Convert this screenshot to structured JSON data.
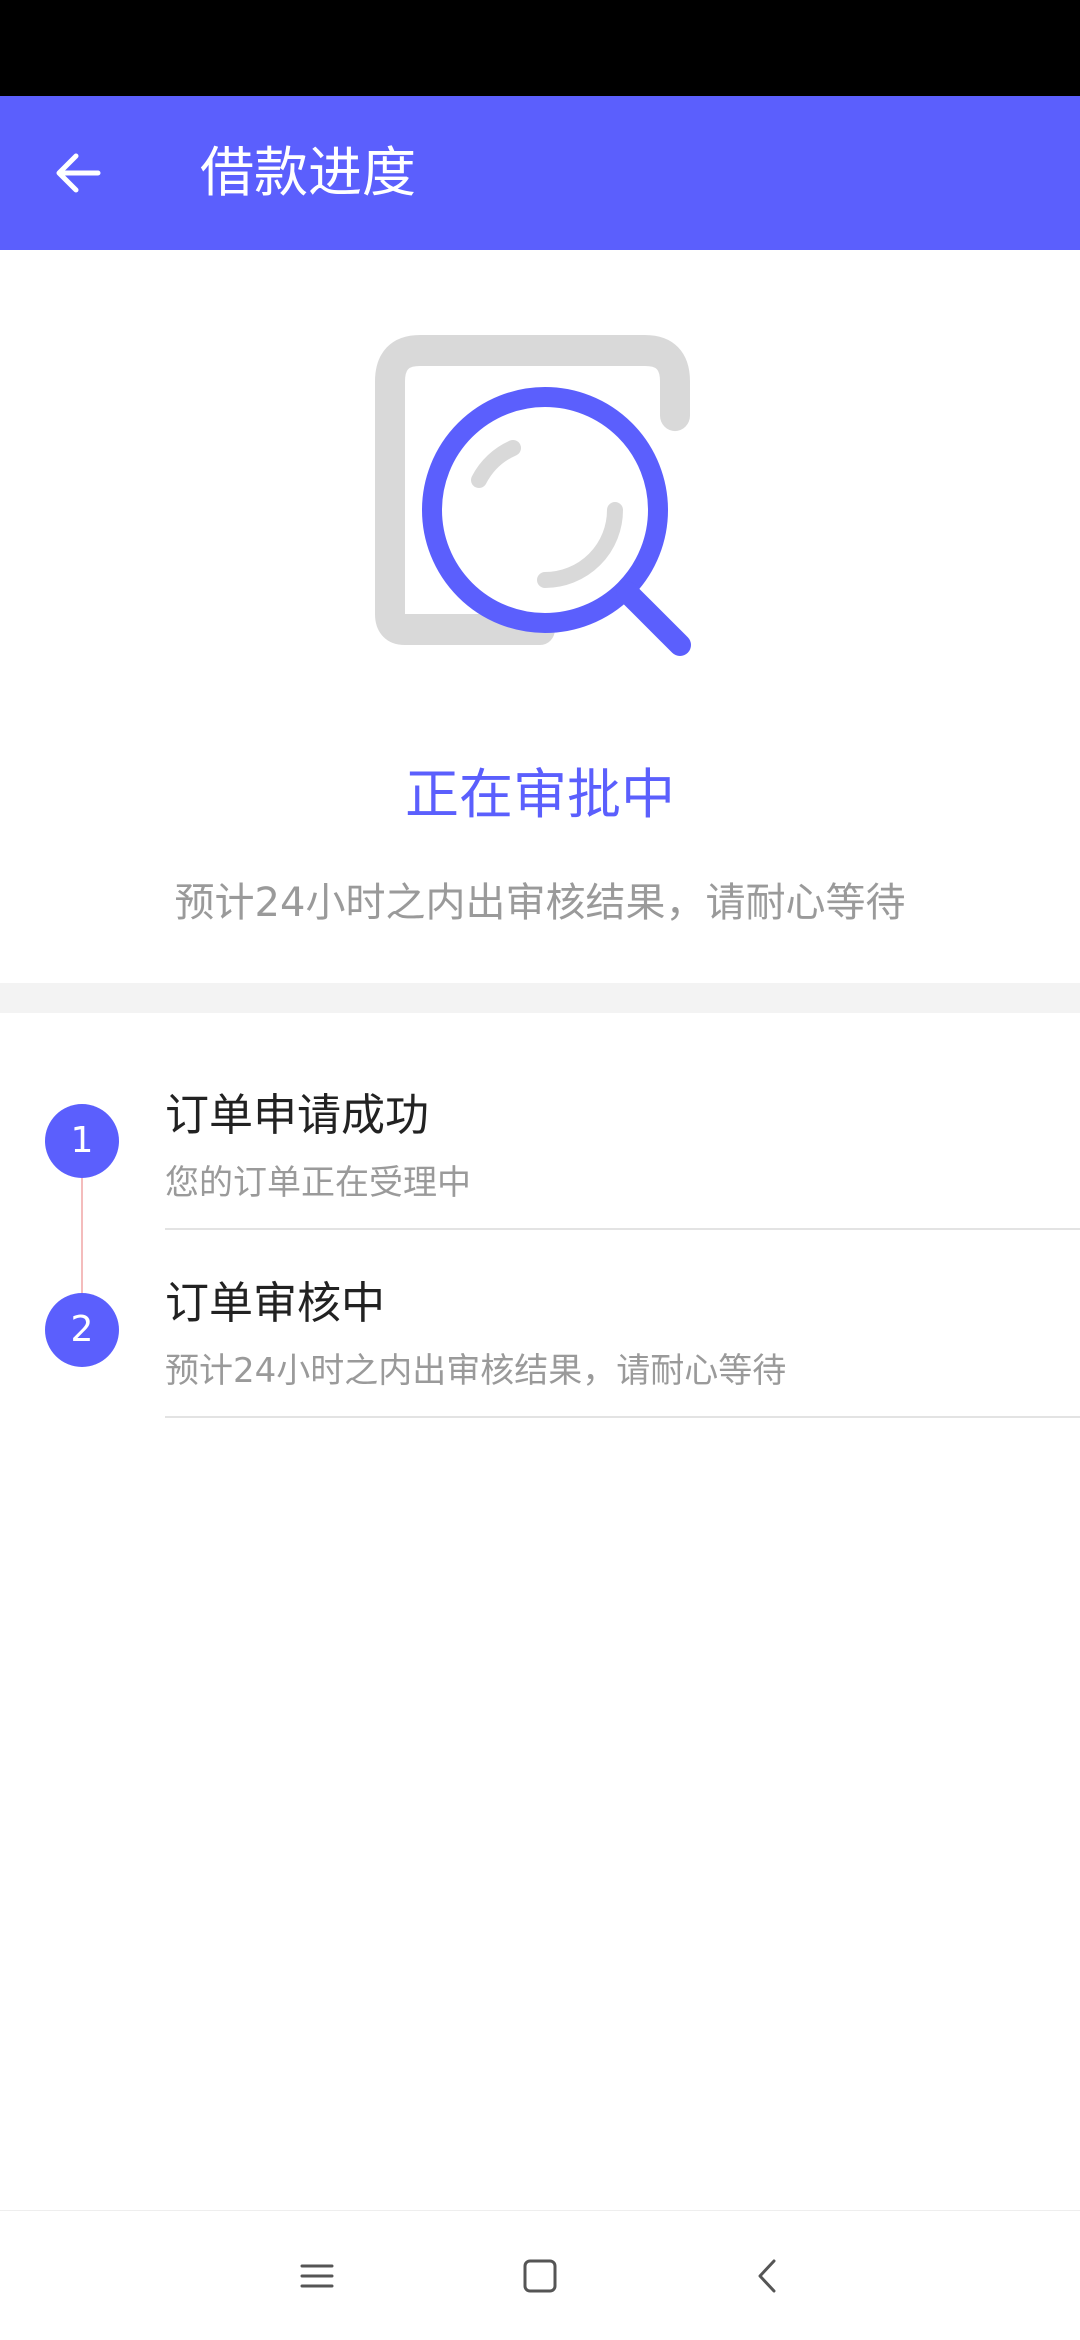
{
  "app_bar": {
    "title": "借款进度"
  },
  "hero": {
    "status_title": "正在审批中",
    "message": "预计24小时之内出审核结果，请耐心等待"
  },
  "timeline": {
    "steps": [
      {
        "number": "1",
        "title": "订单申请成功",
        "description": "您的订单正在受理中"
      },
      {
        "number": "2",
        "title": "订单审核中",
        "description": "预计24小时之内出审核结果，请耐心等待"
      }
    ]
  },
  "icons": {
    "back": "arrow-left-icon",
    "illustration": "document-search-icon",
    "nav_menu": "menu-icon",
    "nav_home": "home-square-icon",
    "nav_back": "chevron-left-icon"
  },
  "colors": {
    "primary": "#5b5ffd",
    "status_bar": "#000000",
    "secondary_text": "#9a9a9a",
    "connector": "#f4bcbc"
  }
}
